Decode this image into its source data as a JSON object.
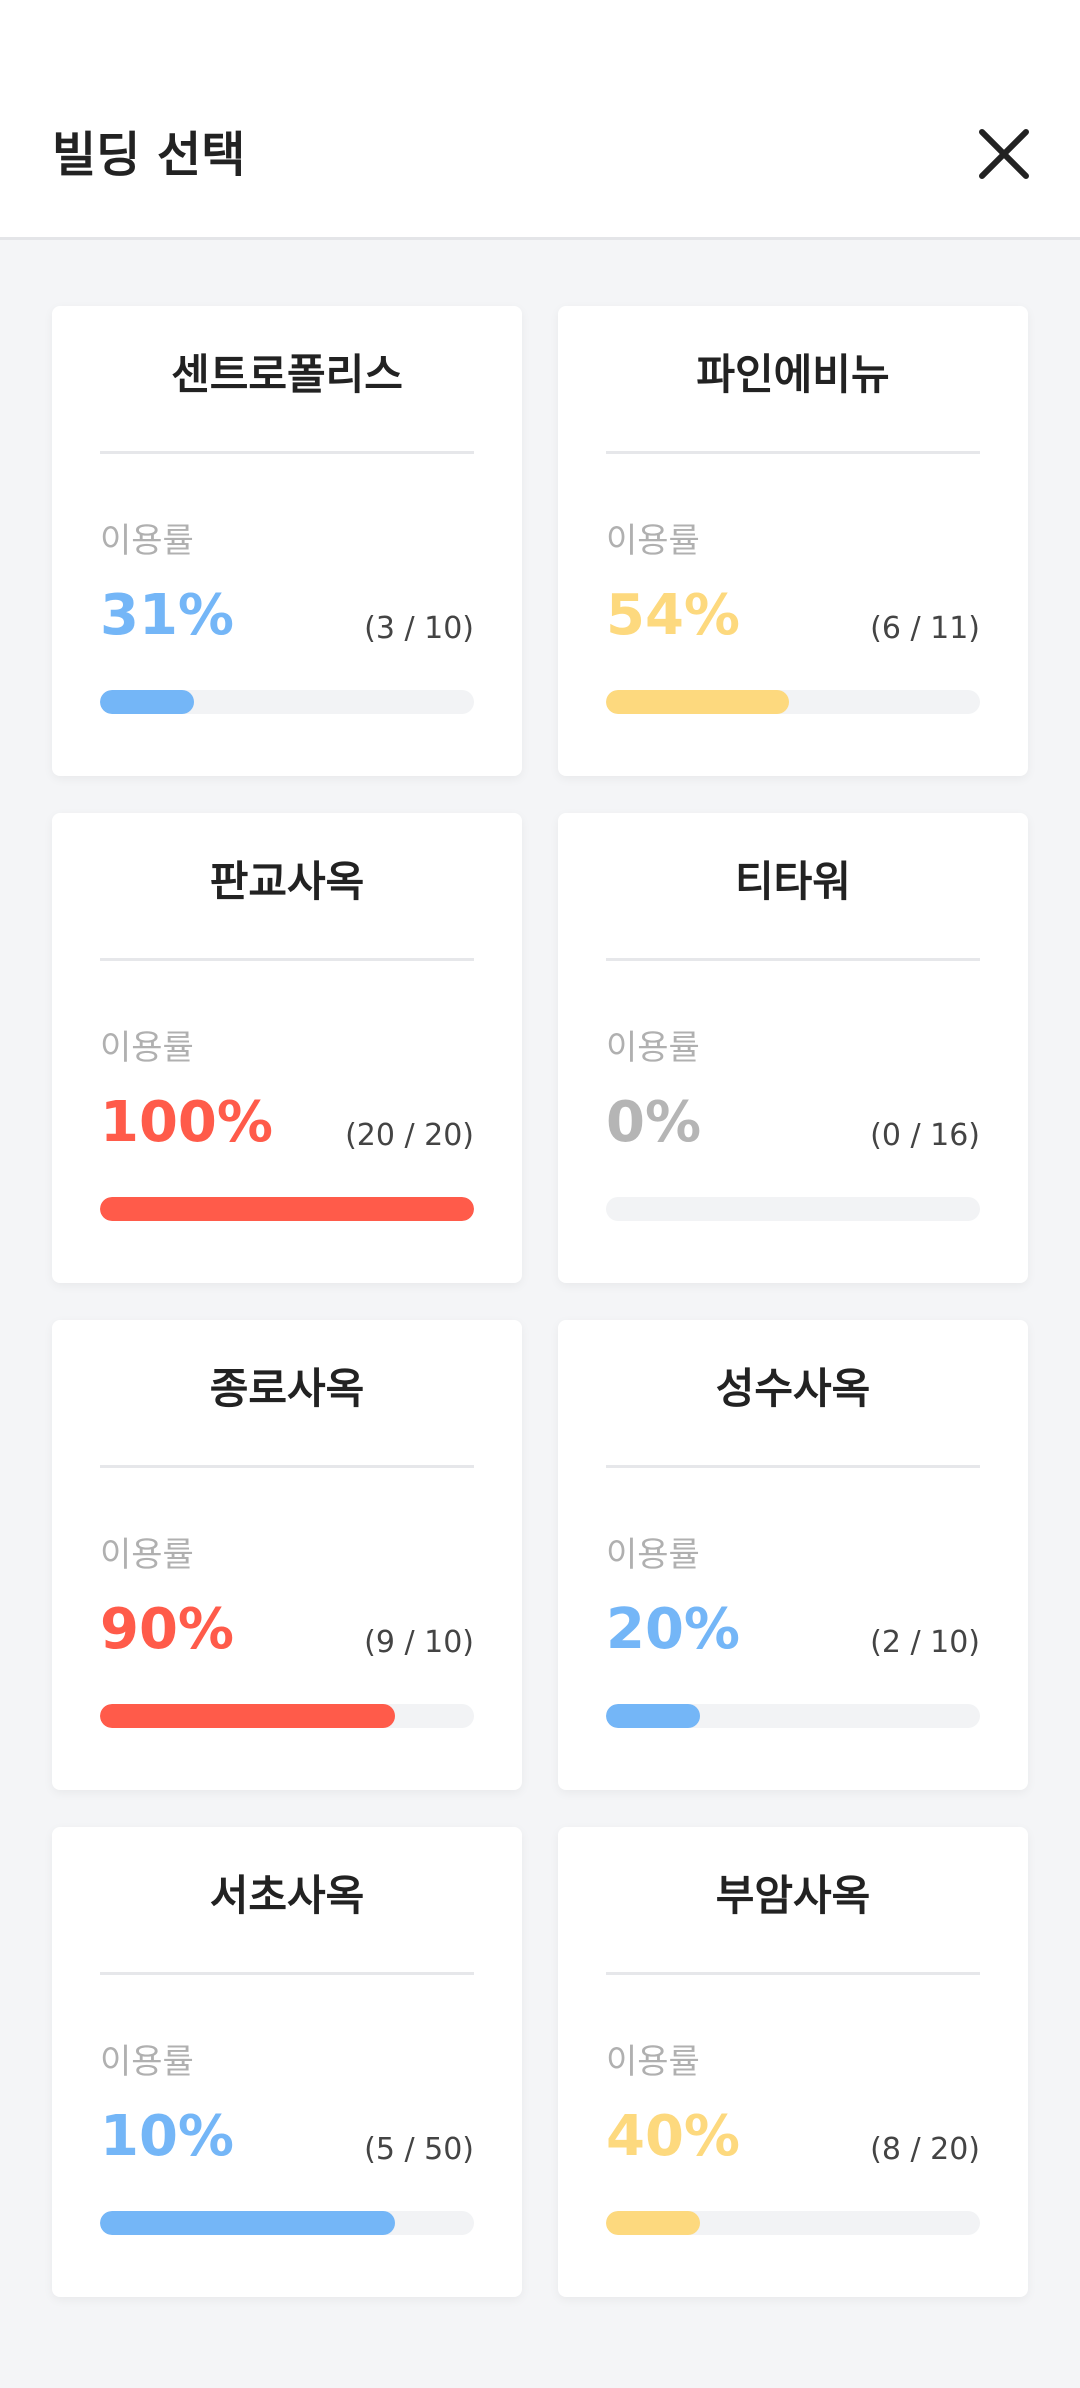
{
  "header": {
    "title": "빌딩 선택",
    "close_icon": "close-icon"
  },
  "colors": {
    "blue": "#74b6f7",
    "yellow": "#fdd97e",
    "red": "#ff5b4a",
    "gray": "#b5b5b5"
  },
  "buildings": [
    {
      "name": "센트로폴리스",
      "usage_label": "이용률",
      "percent": "31%",
      "ratio": "(3 / 10)",
      "fill": 0.25,
      "color": "#74b6f7"
    },
    {
      "name": "파인에비뉴",
      "usage_label": "이용률",
      "percent": "54%",
      "ratio": "(6 / 11)",
      "fill": 0.49,
      "color": "#fdd97e"
    },
    {
      "name": "판교사옥",
      "usage_label": "이용률",
      "percent": "100%",
      "ratio": "(20 / 20)",
      "fill": 1.0,
      "color": "#ff5b4a"
    },
    {
      "name": "티타워",
      "usage_label": "이용률",
      "percent": "0%",
      "ratio": "(0 / 16)",
      "fill": 0.0,
      "color": "#b5b5b5"
    },
    {
      "name": "종로사옥",
      "usage_label": "이용률",
      "percent": "90%",
      "ratio": "(9 / 10)",
      "fill": 0.79,
      "color": "#ff5b4a"
    },
    {
      "name": "성수사옥",
      "usage_label": "이용률",
      "percent": "20%",
      "ratio": "(2 / 10)",
      "fill": 0.25,
      "color": "#74b6f7"
    },
    {
      "name": "서초사옥",
      "usage_label": "이용률",
      "percent": "10%",
      "ratio": "(5 / 50)",
      "fill": 0.79,
      "color": "#74b6f7"
    },
    {
      "name": "부암사옥",
      "usage_label": "이용률",
      "percent": "40%",
      "ratio": "(8 / 20)",
      "fill": 0.25,
      "color": "#fdd97e"
    }
  ]
}
